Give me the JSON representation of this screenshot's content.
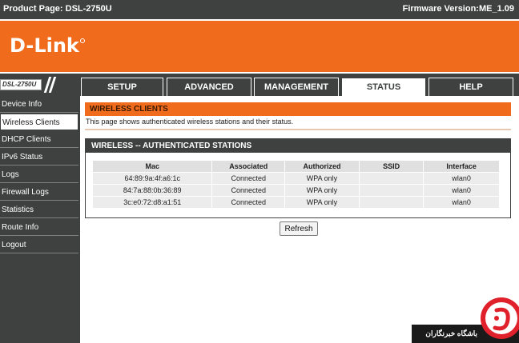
{
  "topbar": {
    "product_page": "Product Page: DSL-2750U",
    "firmware": "Firmware Version:ME_1.09"
  },
  "brand": {
    "logo": "D-Link",
    "model_label": "DSL-2750U"
  },
  "tabs": [
    {
      "label": "SETUP",
      "active": false
    },
    {
      "label": "ADVANCED",
      "active": false
    },
    {
      "label": "MANAGEMENT",
      "active": false
    },
    {
      "label": "STATUS",
      "active": true
    },
    {
      "label": "HELP",
      "active": false
    }
  ],
  "sidebar": {
    "items": [
      {
        "label": "Device Info"
      },
      {
        "label": "Wireless Clients"
      },
      {
        "label": "DHCP Clients"
      },
      {
        "label": "IPv6 Status"
      },
      {
        "label": "Logs"
      },
      {
        "label": "Firewall Logs"
      },
      {
        "label": "Statistics"
      },
      {
        "label": "Route Info"
      },
      {
        "label": "Logout"
      }
    ],
    "active_index": 1
  },
  "main": {
    "title": "WIRELESS CLIENTS",
    "description": "This page shows authenticated wireless stations and their status.",
    "section_title": "WIRELESS -- AUTHENTICATED STATIONS",
    "table": {
      "headers": [
        "Mac",
        "Associated",
        "Authorized",
        "SSID",
        "Interface"
      ],
      "rows": [
        [
          "64:89:9a:4f:a6:1c",
          "Connected",
          "WPA only",
          "",
          "wlan0"
        ],
        [
          "84:7a:88:0b:36:89",
          "Connected",
          "WPA only",
          "",
          "wlan0"
        ],
        [
          "3c:e0:72:d8:a1:51",
          "Connected",
          "WPA only",
          "",
          "wlan0"
        ]
      ]
    },
    "refresh_label": "Refresh"
  },
  "watermark": {
    "text": "باشگاه خبرنگاران"
  },
  "colors": {
    "orange": "#f06b1c",
    "dark": "#3f4040"
  }
}
